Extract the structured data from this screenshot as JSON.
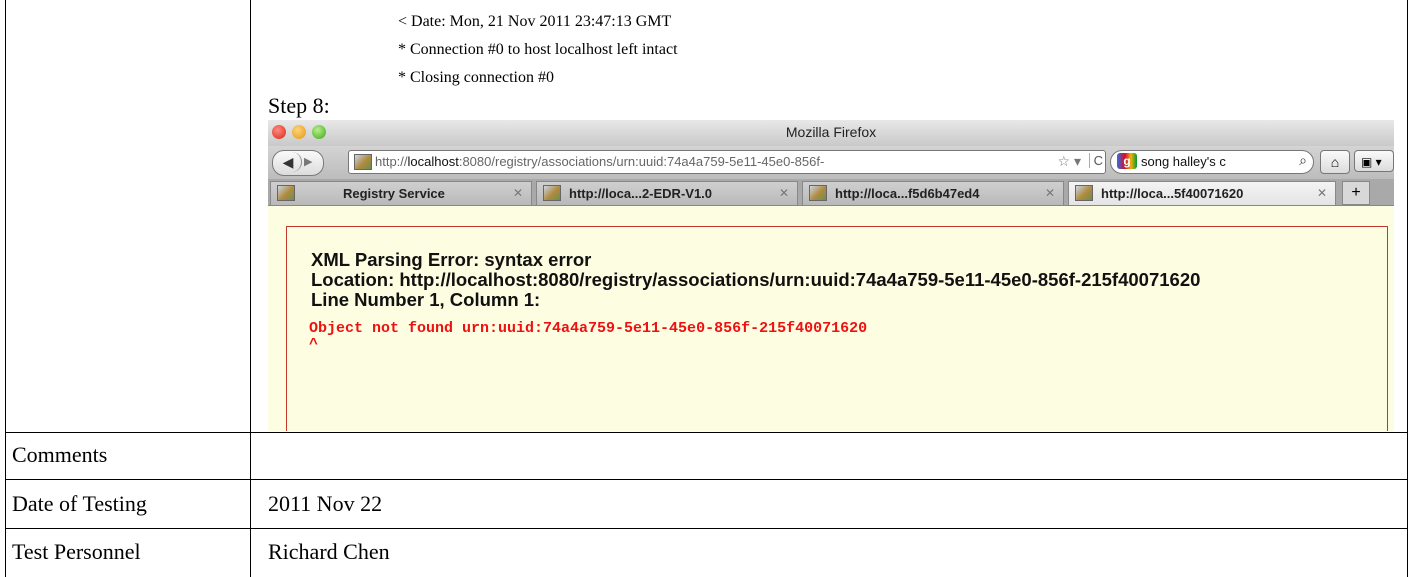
{
  "log_lines": [
    "< Date: Mon, 21 Nov 2011 23:47:13 GMT",
    "* Connection #0 to host localhost left intact",
    "* Closing connection #0"
  ],
  "step_label": "Step 8:",
  "browser": {
    "window_title": "Mozilla Firefox",
    "url_prefix": "http://",
    "url_host": "localhost",
    "url_rest": ":8080/registry/associations/urn:uuid:74a4a759-5e11-45e0-856f-",
    "search_query": "song halley's c",
    "tabs": [
      {
        "label": "Registry Service",
        "active": false
      },
      {
        "label": "http://loca...2-EDR-V1.0",
        "active": false
      },
      {
        "label": "http://loca...f5d6b47ed4",
        "active": false
      },
      {
        "label": "http://loca...5f40071620",
        "active": true
      }
    ],
    "new_tab_label": "+",
    "error": {
      "title": "XML Parsing Error: syntax error",
      "location": "Location: http://localhost:8080/registry/associations/urn:uuid:74a4a759-5e11-45e0-856f-215f40071620",
      "line": "Line Number 1, Column 1:",
      "source": "Object not found urn:uuid:74a4a759-5e11-45e0-856f-215f40071620",
      "caret": "^"
    }
  },
  "table": {
    "rows": [
      {
        "label": "Comments",
        "value": ""
      },
      {
        "label": "Date of Testing",
        "value": "2011 Nov 22"
      },
      {
        "label": "Test Personnel",
        "value": "Richard Chen"
      }
    ]
  },
  "colors": {
    "error_red": "#ee1111",
    "page_bg": "#fdfde1",
    "error_border": "#c0392b"
  }
}
